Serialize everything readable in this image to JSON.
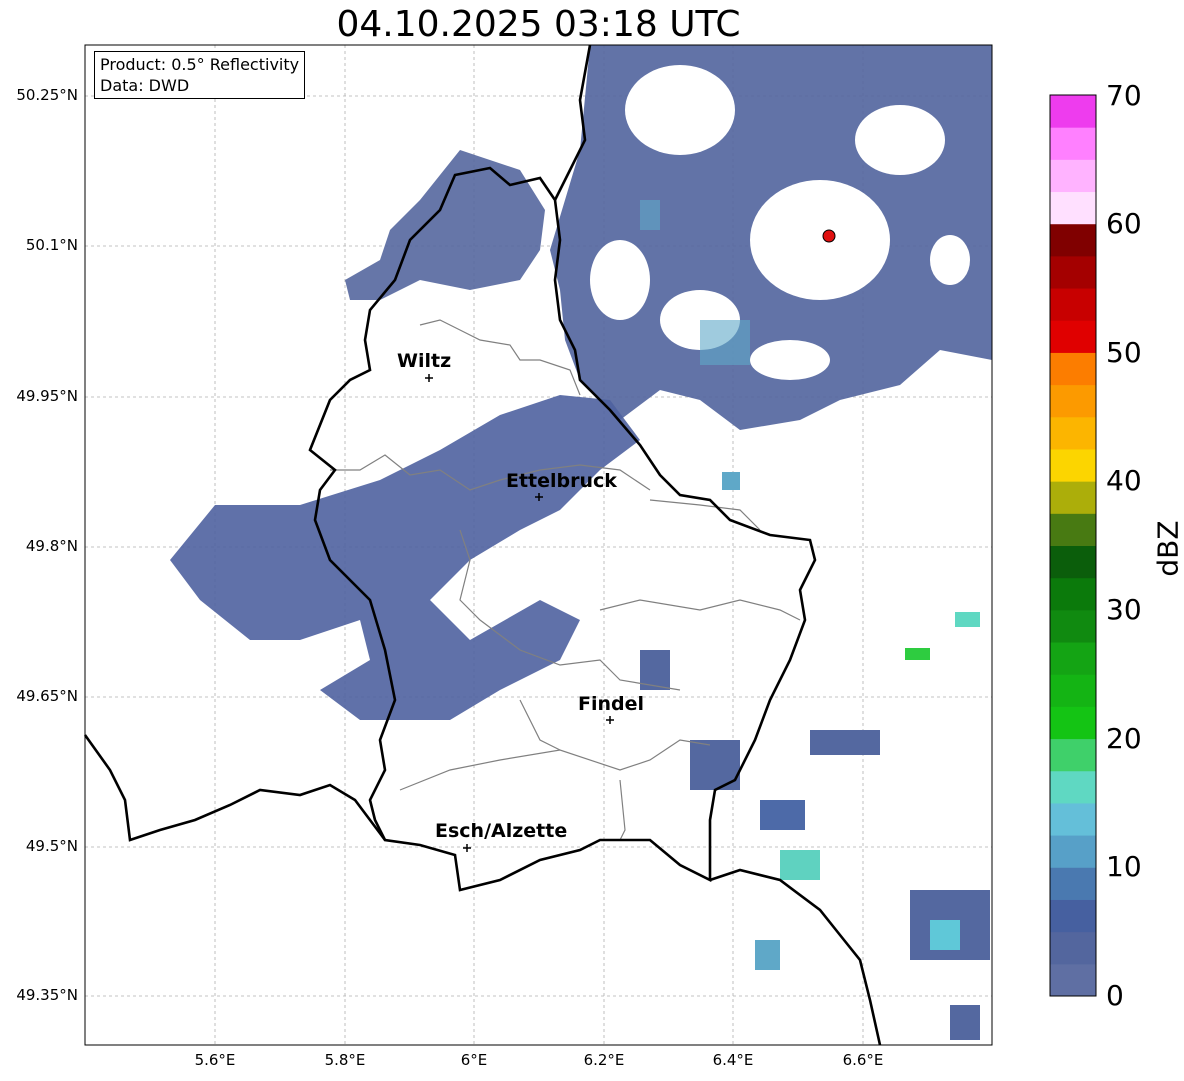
{
  "title": "04.10.2025 03:18 UTC",
  "info": {
    "product": "Product: 0.5° Reflectivity",
    "data": "Data: DWD"
  },
  "axes": {
    "lat_labels": [
      "50.25°N",
      "50.1°N",
      "49.95°N",
      "49.8°N",
      "49.65°N",
      "49.5°N",
      "49.35°N"
    ],
    "lon_labels": [
      "5.6°E",
      "5.8°E",
      "6°E",
      "6.2°E",
      "6.4°E",
      "6.6°E"
    ]
  },
  "colorbar": {
    "unit": "dBZ",
    "tick_labels": [
      "0",
      "10",
      "20",
      "30",
      "40",
      "50",
      "60",
      "70"
    ],
    "colors": [
      "#5f6fa3",
      "#53669e",
      "#4660a0",
      "#4a79b0",
      "#57a0c8",
      "#64bfd9",
      "#5fd8c2",
      "#3fd06a",
      "#14c414",
      "#14b414",
      "#14a414",
      "#108a10",
      "#0b7a0b",
      "#0b5e0b",
      "#487a12",
      "#acae0a",
      "#fcd500",
      "#fcb500",
      "#fc9a00",
      "#fc7d00",
      "#e00000",
      "#c80000",
      "#a40000",
      "#800000",
      "#ffe0ff",
      "#ffb3ff",
      "#ff80ff",
      "#ee3cee"
    ]
  },
  "cities": [
    {
      "name": "Wiltz"
    },
    {
      "name": "Ettelbruck"
    },
    {
      "name": "Findel"
    },
    {
      "name": "Esch/Alzette"
    }
  ]
}
